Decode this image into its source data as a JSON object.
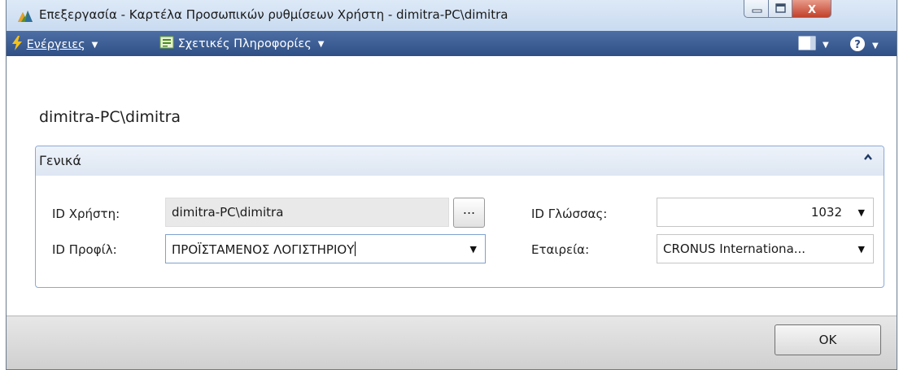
{
  "window": {
    "title": "Επεξεργασία - Καρτέλα Προσωπικών ρυθμίσεων Χρήστη - dimitra-PC\\dimitra",
    "close_glyph": "X"
  },
  "actionbar": {
    "actions_label": "Ενέργειες",
    "related_info_label": "Σχετικές Πληροφορίες"
  },
  "page": {
    "title": "dimitra-PC\\dimitra"
  },
  "general": {
    "header": "Γενικά",
    "user_id_label": "ID Χρήστη:",
    "user_id_value": "dimitra-PC\\dimitra",
    "assist_label": "...",
    "profile_id_label": "ID Προφίλ:",
    "profile_id_value": "ΠΡΟΪΣΤΑΜΕΝΟΣ ΛΟΓΙΣΤΗΡΙΟΥ",
    "language_id_label": "ID Γλώσσας:",
    "language_id_value": "1032",
    "company_label": "Εταιρεία:",
    "company_value": "CRONUS Internationa..."
  },
  "footer": {
    "ok_label": "OK"
  },
  "colors": {
    "action_bar": "#3a5a92",
    "title_bar": "#d3e2f4",
    "fasttab_border": "#8aa9d6"
  }
}
